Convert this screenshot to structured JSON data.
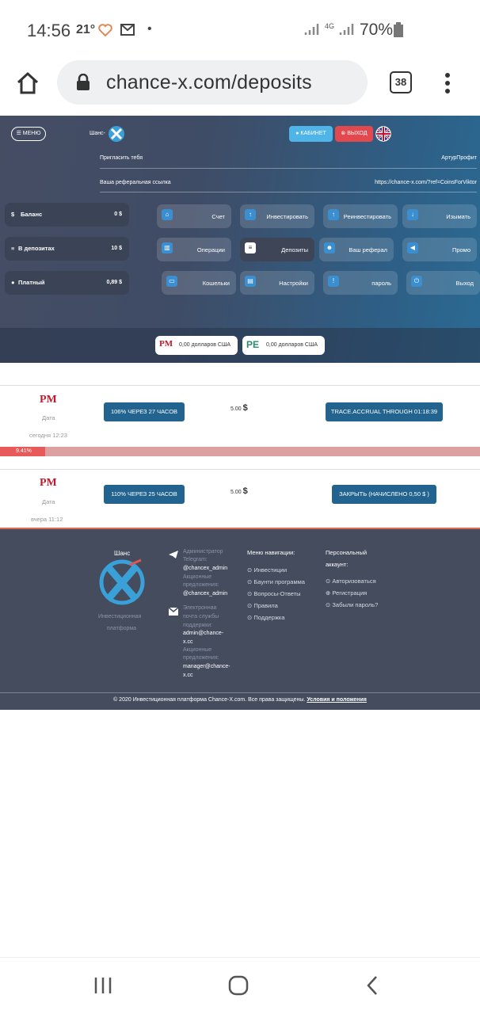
{
  "status_bar": {
    "time": "14:56",
    "temperature": "21°",
    "network": "4G",
    "battery": "70%"
  },
  "browser": {
    "url": "chance-x.com/deposits",
    "tab_count": "38"
  },
  "header": {
    "menu_label": "МЕНЮ",
    "logo_text": "Шанс-",
    "cabinet_label": "КАБИНЕТ",
    "logout_label": "ВЫХОД",
    "invite_label": "Пригласить тебя",
    "invite_name": "АртурПрофит",
    "ref_label": "Ваша реферальная ссылка",
    "ref_link": "https://chance-x.com/?ref=CoinsForViktor"
  },
  "stats": [
    {
      "label": "Баланс",
      "value": "0 $"
    },
    {
      "label": "В депозитах",
      "value": "10 $"
    },
    {
      "label": "Платный",
      "value": "0,89 $"
    }
  ],
  "nav_buttons": [
    {
      "label": "Счет"
    },
    {
      "label": "Инвестировать"
    },
    {
      "label": "Реинвестировать"
    },
    {
      "label": "Изымать"
    },
    {
      "label": "Операции"
    },
    {
      "label": "Депозиты"
    },
    {
      "label": "Ваш реферал"
    },
    {
      "label": "Промо"
    },
    {
      "label": "Кошельки"
    },
    {
      "label": "Настройки"
    },
    {
      "label": "пароль"
    },
    {
      "label": "Выход"
    }
  ],
  "wallets": [
    {
      "logo": "PM",
      "amount": "0,00 долларов США"
    },
    {
      "logo": "PE",
      "amount": "0,00 долларов США"
    }
  ],
  "deposits": [
    {
      "logo": "PM",
      "date_label": "Дата",
      "date": "сегодня 12:23",
      "plan": "106% ЧЕРЕЗ 27 ЧАСОВ",
      "amount": "5.00",
      "currency": "$",
      "action": "TRACE.ACCRUAL THROUGH 01:18:39",
      "progress_label": "9.41%",
      "progress": 9.41
    },
    {
      "logo": "PM",
      "date_label": "Дата",
      "date": "вчера 11:12",
      "plan": "110% ЧЕРЕЗ 25 ЧАСОВ",
      "amount": "5.00",
      "currency": "$",
      "action": "ЗАКРЫТЬ (НАЧИСЛЕНО 0,50 $ )"
    }
  ],
  "footer": {
    "brand": "Шанс",
    "brand_sub1": "Инвестиционная",
    "brand_sub2": "платформа",
    "admin_tg_label1": "Администратор",
    "admin_tg_label2": "Telegram:",
    "admin_tg": "@chancex_admin",
    "promo_label1": "Акционные",
    "promo_label2": "предложения:",
    "promo_tg": "@chancex_admin",
    "email_label1": "Электронная",
    "email_label2": "почта службы",
    "email_label3": "поддержки:",
    "email1a": "admin@chance-",
    "email1b": "x.cc",
    "promo2_label1": "Акционные",
    "promo2_label2": "предложения:",
    "email2a": "manager@chance-",
    "email2b": "x.cc",
    "nav_title": "Меню навигации:",
    "nav_links": [
      "Инвестиции",
      "Баунти программа",
      "Вопросы-Ответы",
      "Правила",
      "Поддержка"
    ],
    "acc_title1": "Персональный",
    "acc_title2": "аккаунт:",
    "acc_links": [
      "Авторизоваться",
      "Регистрация",
      "Забыли пароль?"
    ],
    "copyright": "© 2020 Инвестиционная платформа Chance-X.com. Все права защищены.",
    "terms": "Условия и положения"
  },
  "colors": {
    "accent_blue": "#22648f",
    "header_bg": "#3f4c66",
    "footer_bg": "#444c5e",
    "progress_red": "#e86060"
  }
}
